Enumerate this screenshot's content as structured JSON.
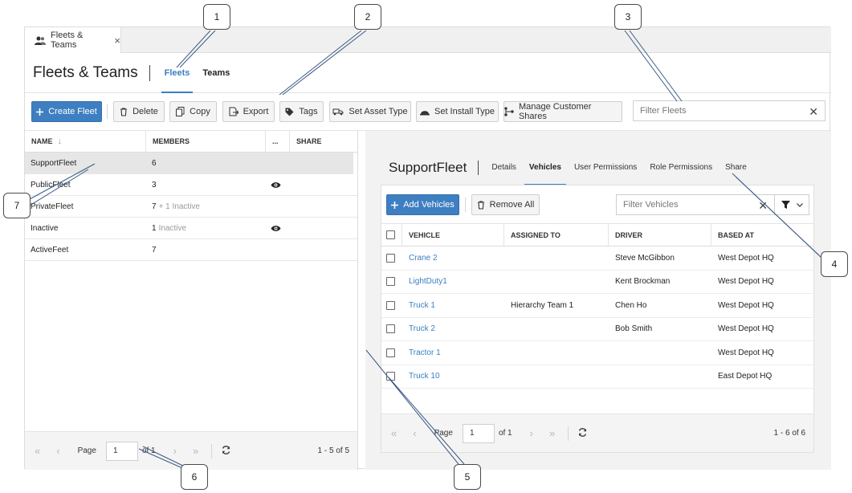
{
  "app_tab": {
    "label": "Fleets & Teams",
    "close": "×"
  },
  "header": {
    "title": "Fleets & Teams",
    "tabs": [
      "Fleets",
      "Teams"
    ]
  },
  "toolbar": {
    "create_fleet": "Create Fleet",
    "delete": "Delete",
    "copy": "Copy",
    "export": "Export",
    "tags": "Tags",
    "set_asset_type": "Set Asset Type",
    "set_install_type": "Set Install Type",
    "manage_customer_shares": "Manage Customer Shares",
    "filter_placeholder": "Filter Fleets"
  },
  "fleet_grid": {
    "columns": [
      "NAME",
      "MEMBERS",
      "...",
      "SHARE"
    ],
    "rows": [
      {
        "name": "SupportFleet",
        "members": "6",
        "inactive": "",
        "shared": false,
        "selected": true
      },
      {
        "name": "PublicFleet",
        "members": "3",
        "inactive": "",
        "shared": true,
        "selected": false
      },
      {
        "name": "PrivateFleet",
        "members": "7",
        "inactive": "+ 1 Inactive",
        "shared": false,
        "selected": false
      },
      {
        "name": "Inactive",
        "members": "1",
        "inactive": "Inactive",
        "shared": true,
        "selected": false
      },
      {
        "name": "ActiveFeet",
        "members": "7",
        "inactive": "",
        "shared": false,
        "selected": false
      }
    ]
  },
  "fleet_pager": {
    "page_label": "Page",
    "page": "1",
    "of": "of 1",
    "summary": "1 - 5 of 5"
  },
  "detail": {
    "title": "SupportFleet",
    "tabs": [
      "Details",
      "Vehicles",
      "User Permissions",
      "Role Permissions",
      "Share"
    ],
    "add_vehicles": "Add Vehicles",
    "remove_all": "Remove All",
    "filter_placeholder": "Filter Vehicles",
    "columns": [
      "VEHICLE",
      "ASSIGNED TO",
      "DRIVER",
      "BASED AT"
    ],
    "rows": [
      {
        "vehicle": "Crane 2",
        "assigned": "",
        "driver": "Steve McGibbon",
        "based": "West Depot HQ"
      },
      {
        "vehicle": "LightDuty1",
        "assigned": "",
        "driver": "Kent Brockman",
        "based": "West Depot HQ"
      },
      {
        "vehicle": "Truck 1",
        "assigned": "Hierarchy Team 1",
        "driver": "Chen Ho",
        "based": "West Depot HQ"
      },
      {
        "vehicle": "Truck 2",
        "assigned": "",
        "driver": "Bob Smith",
        "based": "West Depot HQ"
      },
      {
        "vehicle": "Tractor 1",
        "assigned": "",
        "driver": "",
        "based": "West Depot HQ"
      },
      {
        "vehicle": "Truck 10",
        "assigned": "",
        "driver": "",
        "based": "East Depot HQ"
      }
    ],
    "pager": {
      "page_label": "Page",
      "page": "1",
      "of": "of 1",
      "summary": "1 - 6 of 6"
    }
  },
  "callouts": [
    "1",
    "2",
    "3",
    "4",
    "5",
    "6",
    "7"
  ],
  "colors": {
    "accent": "#3a7fc1",
    "primary_button": "#3e7fc1"
  }
}
